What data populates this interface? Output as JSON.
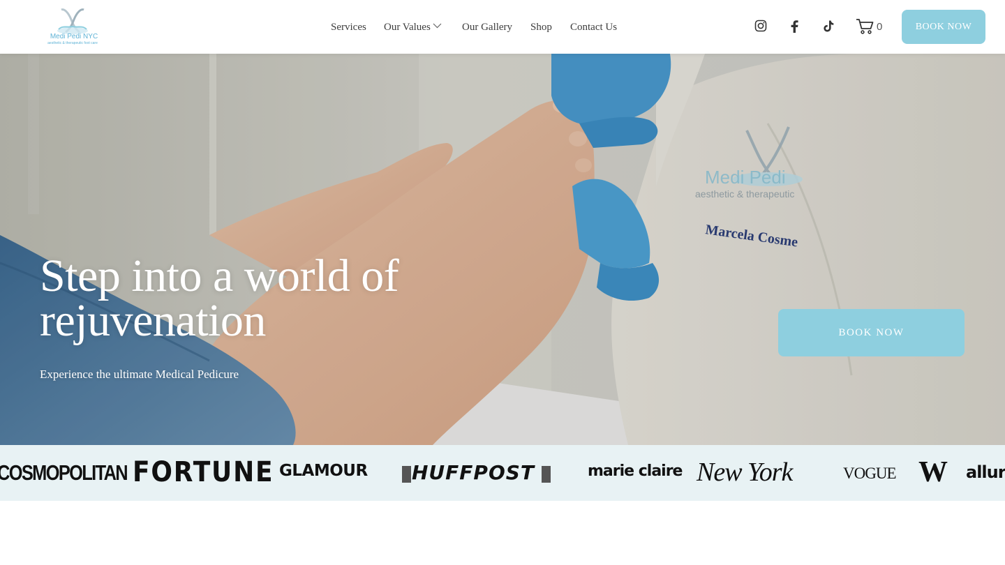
{
  "brand": {
    "name": "Medi Pedi NYC",
    "tagline": "aesthetic & therapeutic foot care",
    "accent": "#8ecfdf"
  },
  "nav": {
    "items": [
      {
        "label": "Services"
      },
      {
        "label": "Our Values",
        "has_dropdown": true
      },
      {
        "label": "Our Gallery"
      },
      {
        "label": "Shop"
      },
      {
        "label": "Contact Us"
      }
    ]
  },
  "social": {
    "icons": [
      "instagram-icon",
      "facebook-icon",
      "tiktok-icon"
    ]
  },
  "cart": {
    "icon": "cart-icon",
    "count": "0"
  },
  "header_cta": {
    "label": "BOOK NOW"
  },
  "hero": {
    "title": "Step into a world of rejuvenation",
    "subtitle": "Experience the ultimate Medical Pedicure",
    "cta_label": "BOOK NOW",
    "coat_name": "Marcela Cosme"
  },
  "press": {
    "logos": [
      "COSMOPOLITAN",
      "FORTUNE",
      "GLAMOUR",
      "HUFFPOST",
      "marie claire",
      "New York",
      "VOGUE",
      "W",
      "allure"
    ]
  }
}
